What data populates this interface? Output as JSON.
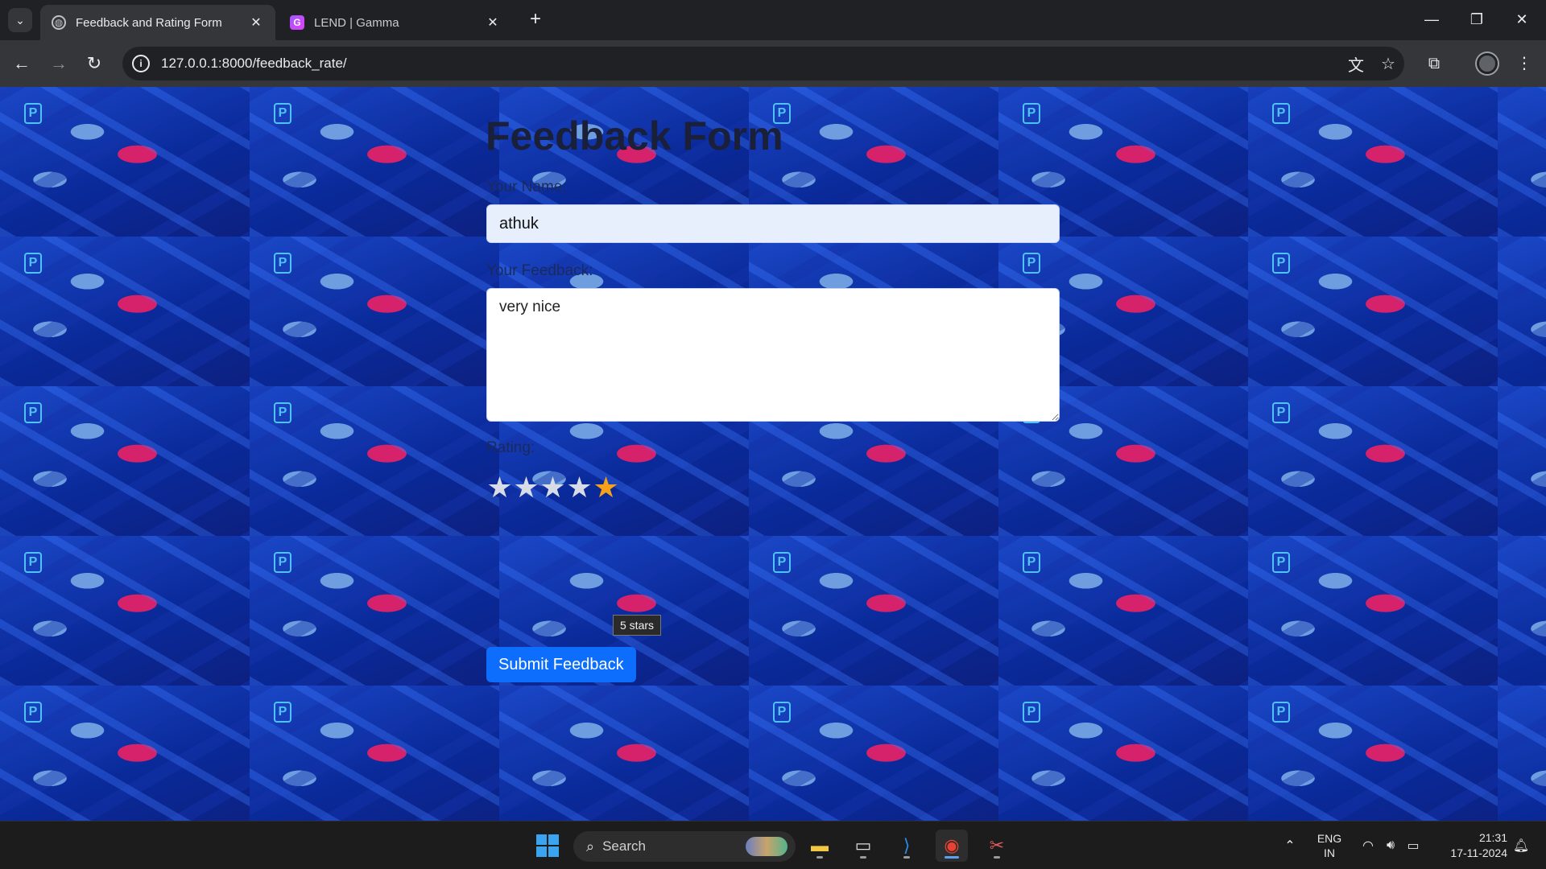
{
  "browser": {
    "tabs": [
      {
        "title": "Feedback and Rating Form",
        "active": true,
        "icon": "globe-icon"
      },
      {
        "title": "LEND | Gamma",
        "active": false,
        "icon": "gamma-icon"
      }
    ],
    "url": "127.0.0.1:8000/feedback_rate/",
    "new_tab_glyph": "+",
    "controls": {
      "minimize": "—",
      "restore": "❐",
      "close": "✕"
    }
  },
  "page": {
    "title": "Feedback Form",
    "name_label": "Your Name:",
    "name_value": "athuk",
    "feedback_label": "Your Feedback:",
    "feedback_value": "very nice",
    "rating_label": "Rating:",
    "rating": {
      "value": 5,
      "max": 5,
      "tooltip": "5 stars"
    },
    "submit_label": "Submit Feedback",
    "colors": {
      "accent": "#0d6efd",
      "star_active": "#f7a11a",
      "background": "#0b2b8f"
    }
  },
  "taskbar": {
    "search_placeholder": "Search",
    "apps": [
      "file-explorer-icon",
      "terminal-icon",
      "vscode-icon",
      "chrome-icon",
      "snipping-tool-icon"
    ],
    "language": {
      "line1": "ENG",
      "line2": "IN"
    },
    "time": "21:31",
    "date": "17-11-2024"
  }
}
